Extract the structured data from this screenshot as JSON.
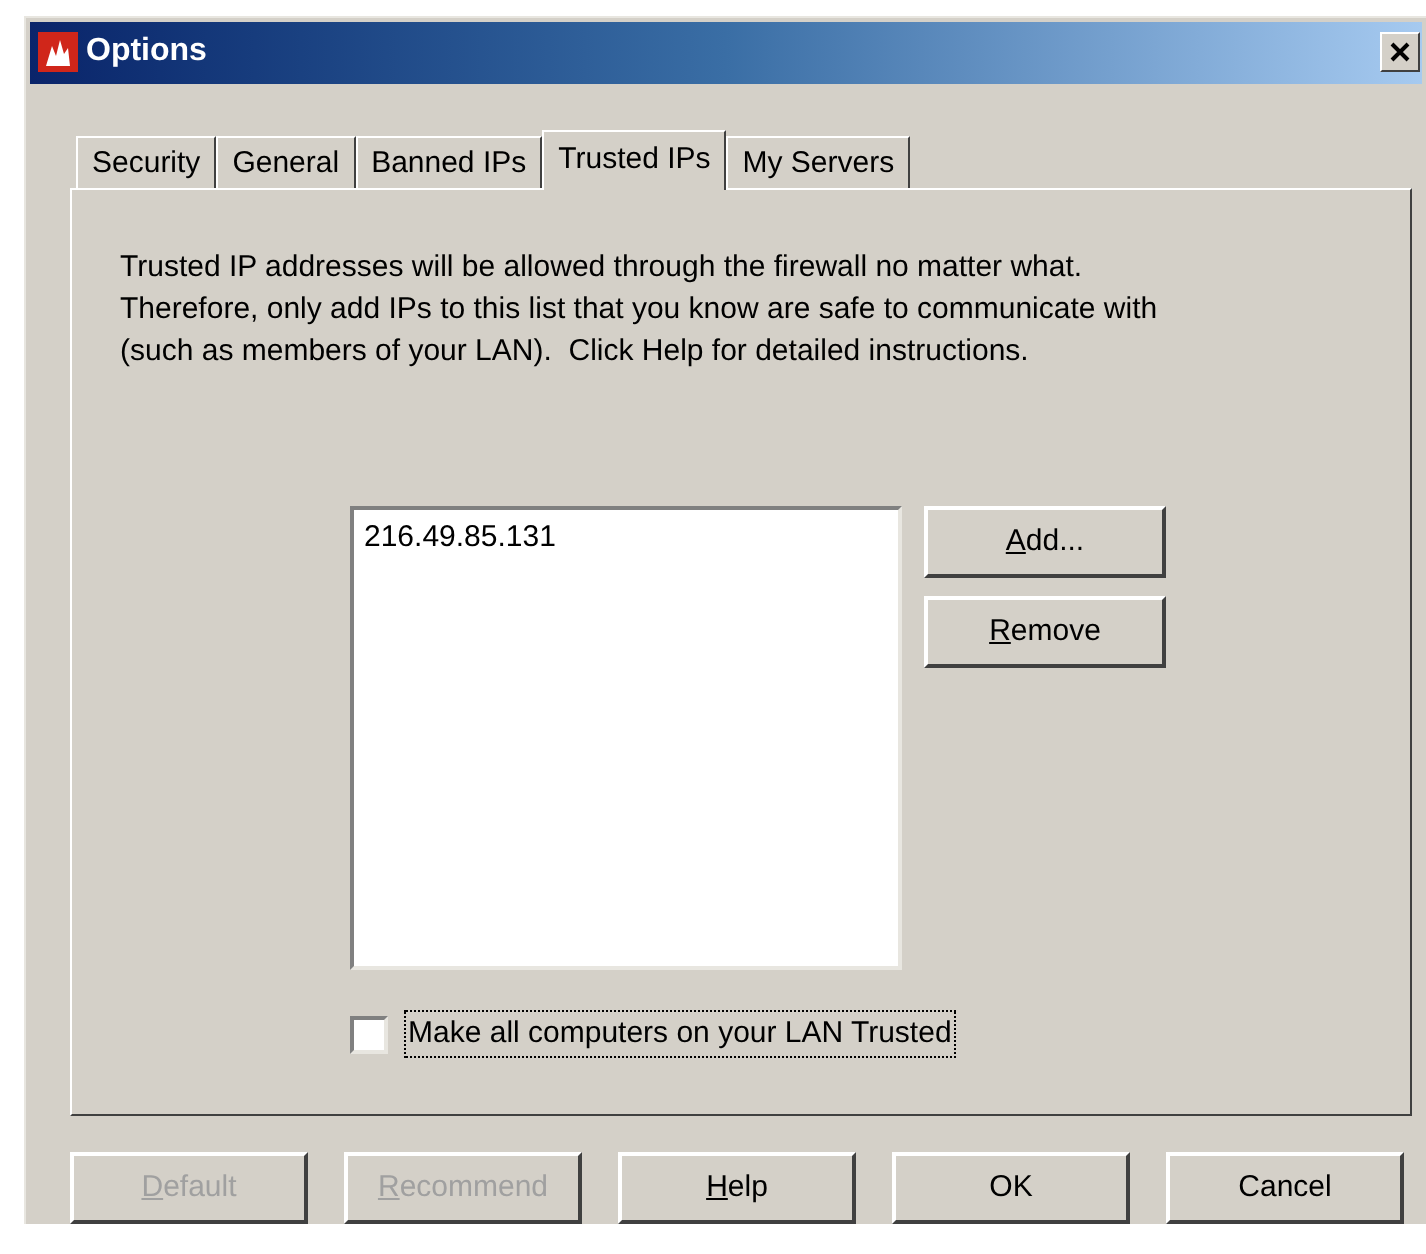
{
  "window": {
    "title": "Options"
  },
  "tabs": [
    {
      "label": "Security",
      "selected": false
    },
    {
      "label": "General",
      "selected": false
    },
    {
      "label": "Banned IPs",
      "selected": false
    },
    {
      "label": "Trusted IPs",
      "selected": true
    },
    {
      "label": "My Servers",
      "selected": false
    }
  ],
  "description": "Trusted IP addresses will be allowed through the firewall no matter what.\nTherefore, only add IPs to this list that you know are safe to communicate with\n(such as members of your LAN).  Click Help for detailed instructions.",
  "trusted_list": {
    "items": [
      "216.49.85.131"
    ]
  },
  "list_buttons": [
    {
      "label": "Add...",
      "mnemonic": true
    },
    {
      "label": "Remove",
      "mnemonic": true
    }
  ],
  "lan_checkbox": {
    "label": "Make all computers on your LAN Trusted",
    "checked": false,
    "focused": true
  },
  "buttons": [
    {
      "label": "Default",
      "mnemonic": true,
      "disabled": true
    },
    {
      "label": "Recommend",
      "mnemonic": true,
      "disabled": true
    },
    {
      "label": "Help",
      "mnemonic": true,
      "disabled": false
    },
    {
      "label": "OK",
      "mnemonic": false,
      "disabled": false
    },
    {
      "label": "Cancel",
      "mnemonic": false,
      "disabled": false
    }
  ]
}
